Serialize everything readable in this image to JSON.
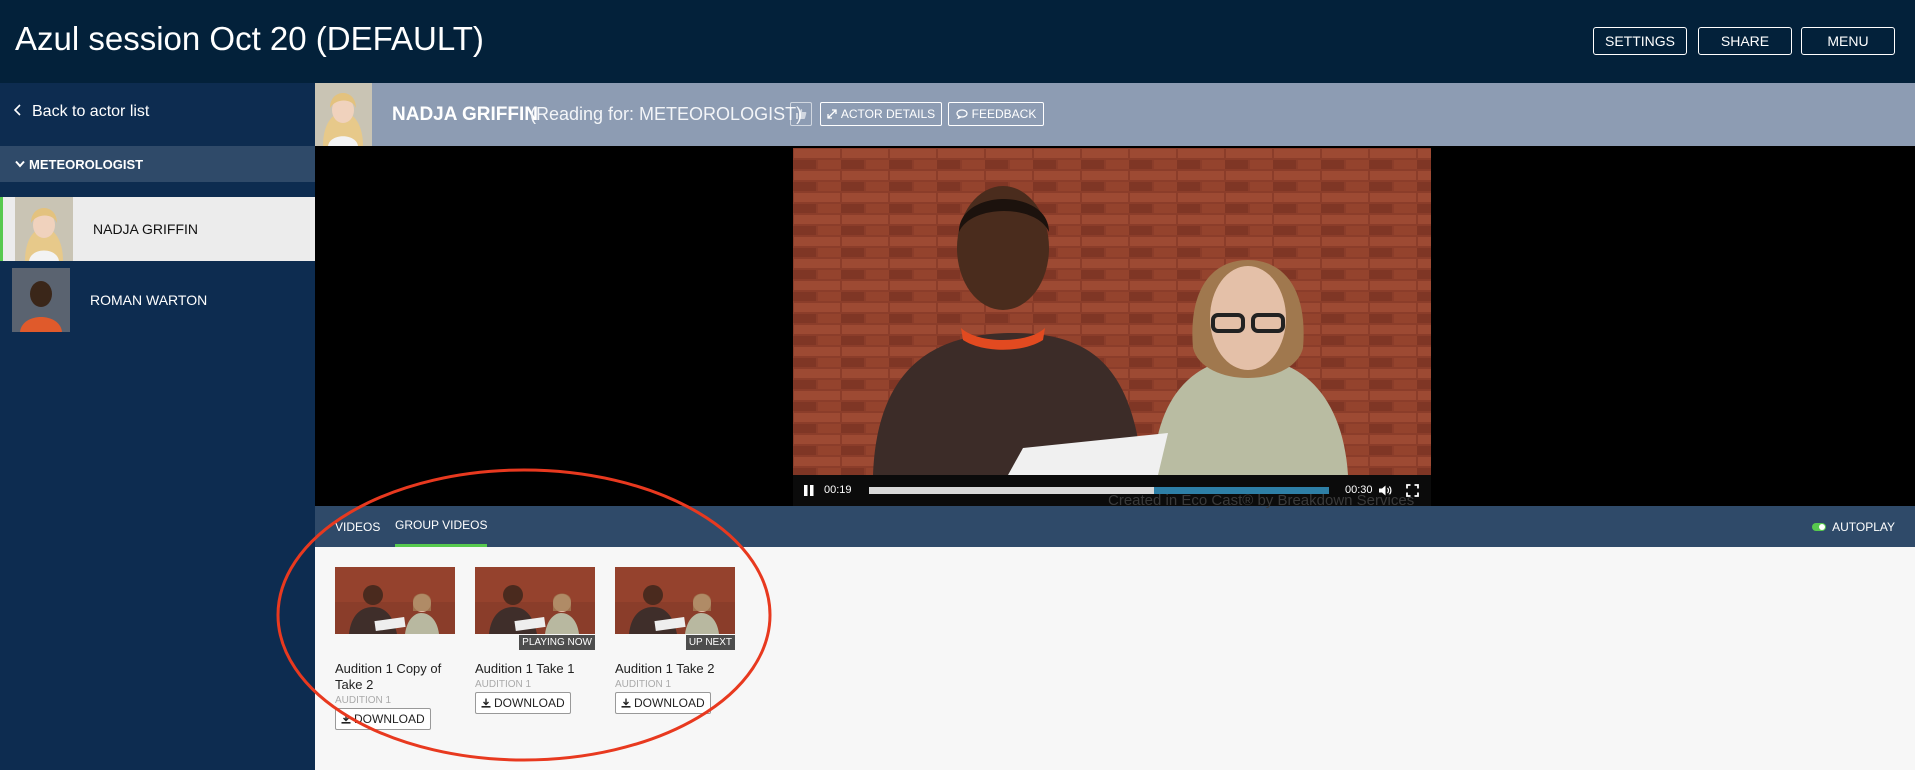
{
  "header": {
    "title": "Azul session Oct 20 (DEFAULT)",
    "settings_label": "SETTINGS",
    "share_label": "SHARE",
    "menu_label": "MENU"
  },
  "sidebar": {
    "back_label": "Back to actor list",
    "role_label": "METEOROLOGIST",
    "actors": [
      {
        "name": "NADJA GRIFFIN",
        "active": true
      },
      {
        "name": "ROMAN WARTON",
        "active": false
      }
    ]
  },
  "actor_header": {
    "name": "NADJA GRIFFIN",
    "reading_for": "(Reading for: METEOROLOGIST)",
    "actor_details_label": "ACTOR DETAILS",
    "feedback_label": "FEEDBACK"
  },
  "player": {
    "current_time": "00:19",
    "duration": "00:30",
    "progress": 0.62,
    "watermark": "Created in Eco Cast® by Breakdown Services"
  },
  "tabs": {
    "videos_label": "VIDEOS",
    "group_videos_label": "GROUP VIDEOS",
    "active": "GROUP VIDEOS",
    "autoplay_label": "AUTOPLAY",
    "autoplay_on": true
  },
  "videos": [
    {
      "title": "Audition 1 Copy of Take 2",
      "subtitle": "AUDITION 1",
      "badge": "",
      "download_label": "DOWNLOAD"
    },
    {
      "title": "Audition 1 Take 1",
      "subtitle": "AUDITION 1",
      "badge": "PLAYING NOW",
      "download_label": "DOWNLOAD"
    },
    {
      "title": "Audition 1 Take 2",
      "subtitle": "AUDITION 1",
      "badge": "UP NEXT",
      "download_label": "DOWNLOAD"
    }
  ],
  "colors": {
    "topbar": "#03213a",
    "sidebar": "#0d2c50",
    "header_band": "#8d9cb3",
    "accent_green": "#57c94e",
    "annotation_red": "#e8391f"
  }
}
